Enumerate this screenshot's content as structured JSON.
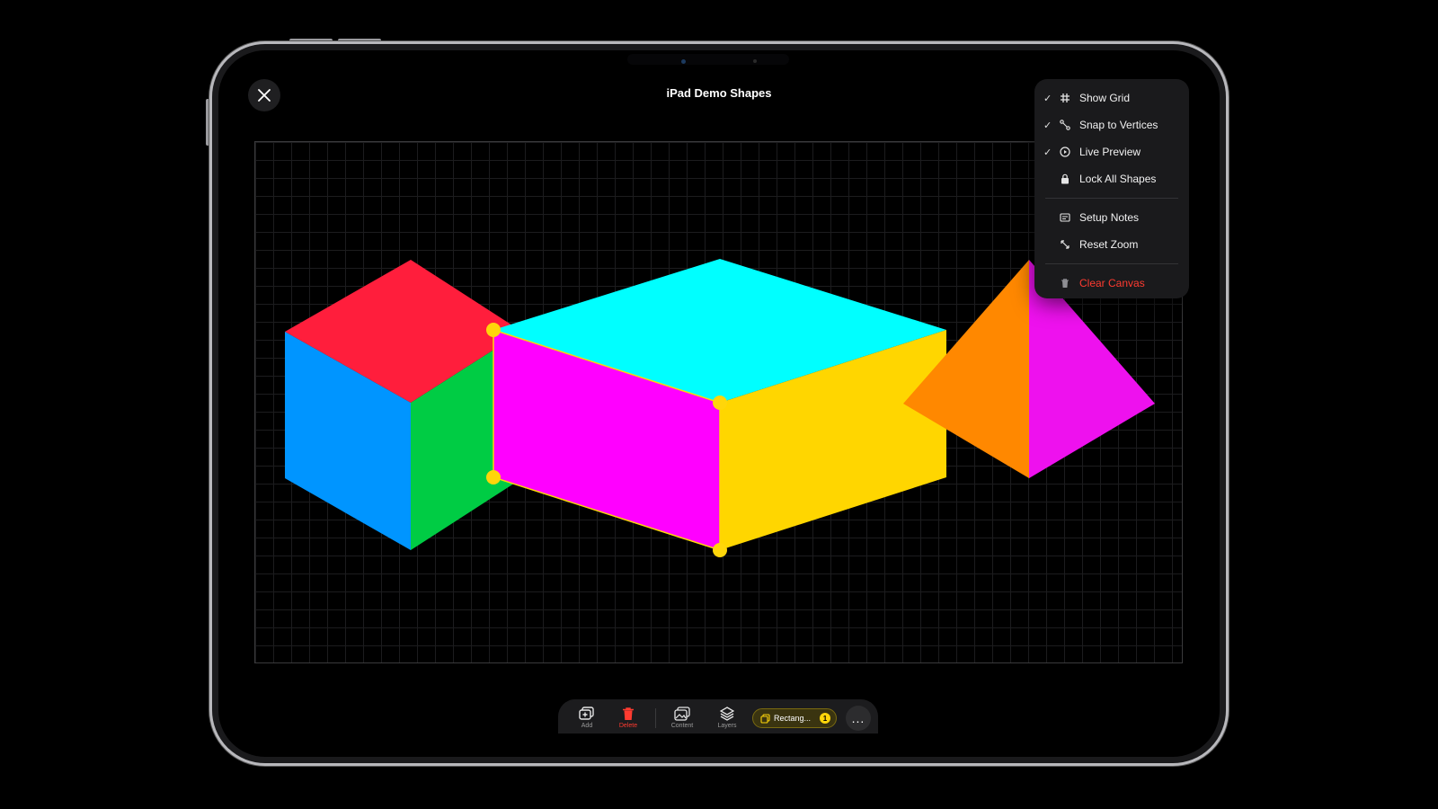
{
  "window": {
    "title": "iPad Demo Shapes"
  },
  "menu": {
    "items": [
      {
        "label": "Show Grid",
        "checked": true,
        "icon": "grid-icon"
      },
      {
        "label": "Snap to Vertices",
        "checked": true,
        "icon": "vertex-icon"
      },
      {
        "label": "Live Preview",
        "checked": true,
        "icon": "play-circle-icon"
      },
      {
        "label": "Lock All Shapes",
        "checked": false,
        "icon": "lock-icon"
      },
      {
        "label": "Setup Notes",
        "checked": false,
        "icon": "notes-icon"
      },
      {
        "label": "Reset Zoom",
        "checked": false,
        "icon": "reset-zoom-icon"
      },
      {
        "label": "Clear Canvas",
        "checked": false,
        "icon": "trash-icon",
        "color": "#ff3b30"
      }
    ],
    "check_glyph": "✓"
  },
  "toolbar": {
    "add_label": "Add",
    "delete_label": "Delete",
    "content_label": "Content",
    "layers_label": "Layers",
    "selection_label": "Rectang...",
    "selection_count": "1",
    "more_label": "..."
  },
  "colors": {
    "accent": "#ffd60a",
    "danger": "#ff3b30",
    "cube_top": "#ff1e3c",
    "cube_left": "#0095ff",
    "cube_right": "#00cc44",
    "box_top": "#00ffff",
    "box_front": "#ff00ff",
    "box_side": "#ffd600",
    "pyramid_left": "#ff8800",
    "pyramid_right": "#ee11ee"
  }
}
